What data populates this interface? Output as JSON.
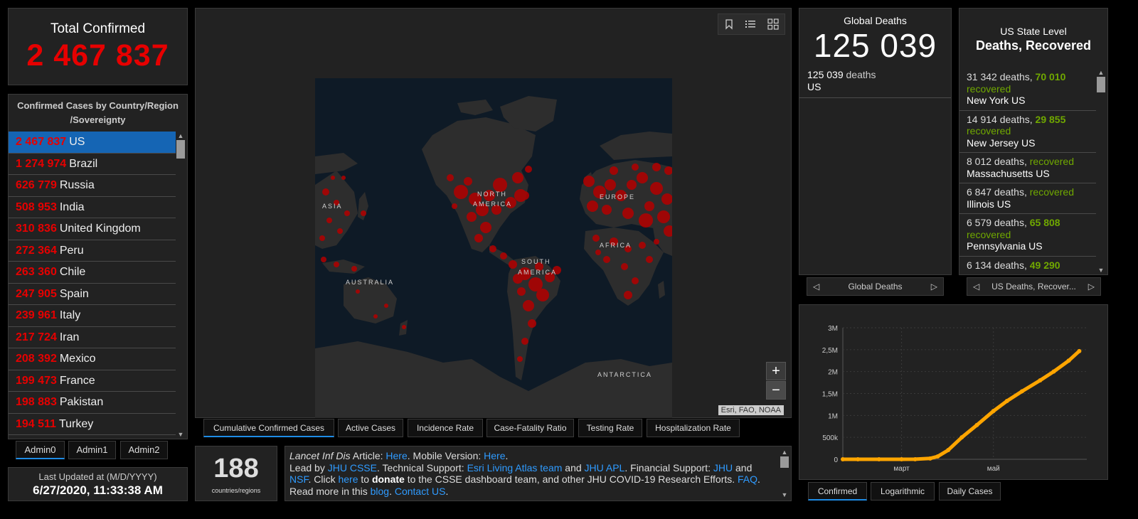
{
  "total": {
    "title": "Total Confirmed",
    "value": "2 467 837"
  },
  "countries": {
    "title": "Confirmed Cases by Country/Region /Sovereignty",
    "rows": [
      {
        "num": "2 467 837",
        "name": "US"
      },
      {
        "num": "1 274 974",
        "name": "Brazil"
      },
      {
        "num": "626 779",
        "name": "Russia"
      },
      {
        "num": "508 953",
        "name": "India"
      },
      {
        "num": "310 836",
        "name": "United Kingdom"
      },
      {
        "num": "272 364",
        "name": "Peru"
      },
      {
        "num": "263 360",
        "name": "Chile"
      },
      {
        "num": "247 905",
        "name": "Spain"
      },
      {
        "num": "239 961",
        "name": "Italy"
      },
      {
        "num": "217 724",
        "name": "Iran"
      },
      {
        "num": "208 392",
        "name": "Mexico"
      },
      {
        "num": "199 473",
        "name": "France"
      },
      {
        "num": "198 883",
        "name": "Pakistan"
      },
      {
        "num": "194 511",
        "name": "Turkey"
      }
    ]
  },
  "admin_tabs": [
    "Admin0",
    "Admin1",
    "Admin2"
  ],
  "updated": {
    "label": "Last Updated at (M/D/YYYY)",
    "value": "6/27/2020, 11:33:38 AM"
  },
  "map": {
    "labels": {
      "asia": "ASIA",
      "north": "NORTH",
      "america": "AMERICA",
      "europe": "EUROPE",
      "africa": "AFRICA",
      "south": "SOUTH",
      "australia": "AUSTRALIA",
      "antarctica": "ANTARCTICA"
    },
    "attribution": "Esri, FAO, NOAA",
    "zoom_in": "+",
    "zoom_out": "−",
    "tabs": [
      "Cumulative Confirmed Cases",
      "Active Cases",
      "Incidence Rate",
      "Case-Fatality Ratio",
      "Testing Rate",
      "Hospitalization Rate"
    ]
  },
  "count": {
    "value": "188",
    "label": "countries/regions"
  },
  "info": {
    "t1": "Lancet Inf Dis",
    "t2": " Article: ",
    "l_here1": "Here",
    "t3": ". Mobile Version: ",
    "l_here2": "Here",
    "t4": ".",
    "t5": "Lead by ",
    "l_jhucsse": "JHU CSSE",
    "t6": ". Technical Support: ",
    "l_esri": "Esri Living Atlas team",
    "t7": " and ",
    "l_jhuapl": "JHU APL",
    "t8": ". Financial Support: ",
    "l_jhu": "JHU",
    "t9": " and ",
    "l_nsf": "NSF",
    "t10": ". Click ",
    "l_here3": "here",
    "t11": " to ",
    "b_donate": "donate",
    "t12": " to the CSSE dashboard team, and other JHU COVID-19 Research Efforts. ",
    "l_faq": "FAQ",
    "t13": ". Read more in this ",
    "l_blog": "blog",
    "t14": ". ",
    "l_contact": "Contact US",
    "t15": "."
  },
  "global_deaths": {
    "title": "Global Deaths",
    "value": "125 039",
    "entry_num": "125 039",
    "entry_suffix": " deaths",
    "entry_place": "US",
    "pager_label": "Global Deaths"
  },
  "state": {
    "title1": "US State Level",
    "title2": "Deaths, Recovered",
    "rows": [
      {
        "deaths": "31 342 deaths, ",
        "rec": "70 010",
        "rec_label": "recovered",
        "place": "New York US"
      },
      {
        "deaths": "14 914 deaths, ",
        "rec": "29 855",
        "rec_label": "recovered",
        "place": "New Jersey US"
      },
      {
        "deaths": "8 012 deaths, ",
        "rec": "",
        "rec_label": "recovered",
        "place": "Massachusetts US"
      },
      {
        "deaths": "6 847 deaths, ",
        "rec": "",
        "rec_label": "recovered",
        "place": "Illinois US"
      },
      {
        "deaths": "6 579 deaths, ",
        "rec": "65 808",
        "rec_label": "recovered",
        "place": "Pennsylvania US"
      },
      {
        "deaths": "6 134 deaths, ",
        "rec": "49 290",
        "rec_label": "",
        "place": ""
      }
    ],
    "pager_label": "US Deaths, Recover..."
  },
  "chart_tabs": [
    "Confirmed",
    "Logarithmic",
    "Daily Cases"
  ],
  "colors": {
    "accent_red": "#e60000",
    "recovered_green": "#70a800",
    "link_blue": "#2f9bff",
    "line_orange": "#ffa500",
    "selected_blue": "#1565b4"
  },
  "chart_data": {
    "type": "line",
    "x_tick_labels": [
      "март",
      "май"
    ],
    "y_tick_labels": [
      "0",
      "500k",
      "1M",
      "1,5M",
      "2M",
      "2,5M",
      "3M"
    ],
    "ylim": [
      0,
      3000000
    ],
    "series": [
      {
        "dates": [
          "2020-01-22",
          "2020-02-01",
          "2020-02-15",
          "2020-03-01",
          "2020-03-10",
          "2020-03-20",
          "2020-03-25",
          "2020-04-01",
          "2020-04-10",
          "2020-04-20",
          "2020-05-01",
          "2020-05-10",
          "2020-05-20",
          "2020-06-01",
          "2020-06-10",
          "2020-06-20",
          "2020-06-27"
        ],
        "values": [
          1,
          8,
          15,
          70,
          1000,
          19000,
          65000,
          210000,
          500000,
          780000,
          1100000,
          1330000,
          1550000,
          1800000,
          2000000,
          2250000,
          2467837
        ]
      }
    ]
  }
}
